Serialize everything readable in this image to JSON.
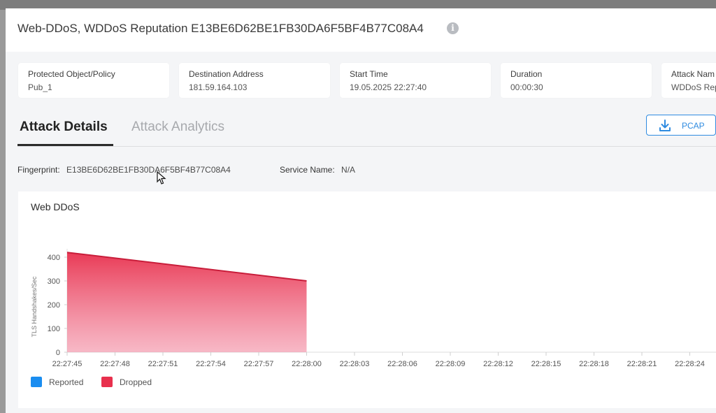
{
  "modal": {
    "title": "Web-DDoS, WDDoS Reputation E13BE6D62BE1FB30DA6F5BF4B77C08A4",
    "info_icon": "info-icon"
  },
  "cards": [
    {
      "label": "Protected Object/Policy",
      "value": "Pub_1"
    },
    {
      "label": "Destination Address",
      "value": "181.59.164.103"
    },
    {
      "label": "Start Time",
      "value": "19.05.2025 22:27:40"
    },
    {
      "label": "Duration",
      "value": "00:00:30"
    },
    {
      "label": "Attack Nam",
      "value": "WDDoS Rep"
    }
  ],
  "tabs": {
    "active": "Attack Details",
    "inactive": "Attack Analytics"
  },
  "pcap_button": {
    "label": "PCAP",
    "icon": "download-icon"
  },
  "details": {
    "fingerprint_label": "Fingerprint:",
    "fingerprint_value": "E13BE6D62BE1FB30DA6F5BF4B77C08A4",
    "service_label": "Service Name:",
    "service_value": "N/A"
  },
  "colors": {
    "accent": "#2f8be0",
    "reported": "#1a8df0",
    "dropped": "#e8304d"
  },
  "chart_data": {
    "type": "area",
    "title": "Web DDoS",
    "xlabel": "",
    "ylabel": "TLS Handshakes/Sec",
    "ylim": [
      0,
      400
    ],
    "yticks": [
      0,
      100,
      200,
      300,
      400
    ],
    "x": [
      "22:27:45",
      "22:27:48",
      "22:27:51",
      "22:27:54",
      "22:27:57",
      "22:28:00",
      "22:28:03",
      "22:28:06",
      "22:28:09",
      "22:28:12",
      "22:28:15",
      "22:28:18",
      "22:28:21",
      "22:28:24"
    ],
    "series": [
      {
        "name": "Reported",
        "color": "#1a8df0",
        "points": []
      },
      {
        "name": "Dropped",
        "color": "#e8304d",
        "points": [
          {
            "x": "22:27:45",
            "y": 420
          },
          {
            "x": "22:28:00",
            "y": 300
          }
        ]
      }
    ],
    "legend": [
      "Reported",
      "Dropped"
    ],
    "legend_position": "bottom-left",
    "grid": false
  }
}
